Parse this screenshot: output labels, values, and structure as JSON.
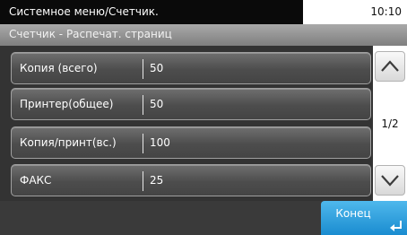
{
  "header": {
    "title": "Системное меню/Счетчик.",
    "time": "10:10"
  },
  "subheader": {
    "title": "Счетчик - Распечат. страниц"
  },
  "counters": [
    {
      "label": "Копия (всего)",
      "value": "50"
    },
    {
      "label": "Принтер(общее)",
      "value": "50"
    },
    {
      "label": "Копия/принт(вс.)",
      "value": "100"
    },
    {
      "label": "ФАКС",
      "value": "25"
    }
  ],
  "pagination": {
    "indicator": "1/2",
    "up_icon": "chevron-up-icon",
    "down_icon": "chevron-down-icon"
  },
  "footer": {
    "end_label": "Конец",
    "end_icon": "enter-icon"
  },
  "colors": {
    "accent": "#1a8cd0",
    "row_bg": "#4d4d4d"
  }
}
